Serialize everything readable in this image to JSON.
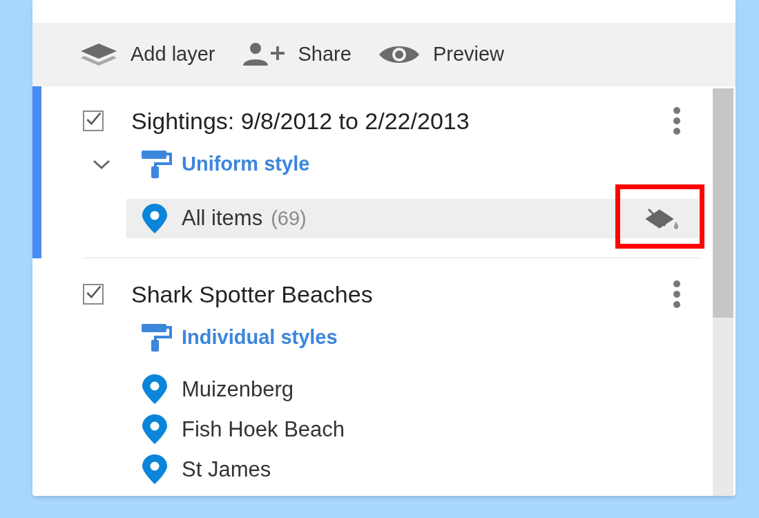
{
  "toolbar": [
    {
      "kind": "layers",
      "label": "Add layer"
    },
    {
      "kind": "share",
      "label": "Share"
    },
    {
      "kind": "preview",
      "label": "Preview"
    }
  ],
  "layers": [
    {
      "title": "Sightings: 9/8/2012 to 2/22/2013",
      "checked": true,
      "selected": true,
      "expand_toggle": true,
      "style": "Uniform style",
      "items": [
        {
          "label": "All items",
          "count": "(69)",
          "selected": true,
          "annotated": true
        }
      ]
    },
    {
      "title": "Shark Spotter Beaches",
      "checked": true,
      "selected": false,
      "expand_toggle": false,
      "style": "Individual styles",
      "items": [
        {
          "label": "Muizenberg",
          "selected": false,
          "annotated": false
        },
        {
          "label": "Fish Hoek Beach",
          "selected": false,
          "annotated": false
        },
        {
          "label": "St James",
          "selected": false,
          "annotated": false
        }
      ]
    }
  ]
}
